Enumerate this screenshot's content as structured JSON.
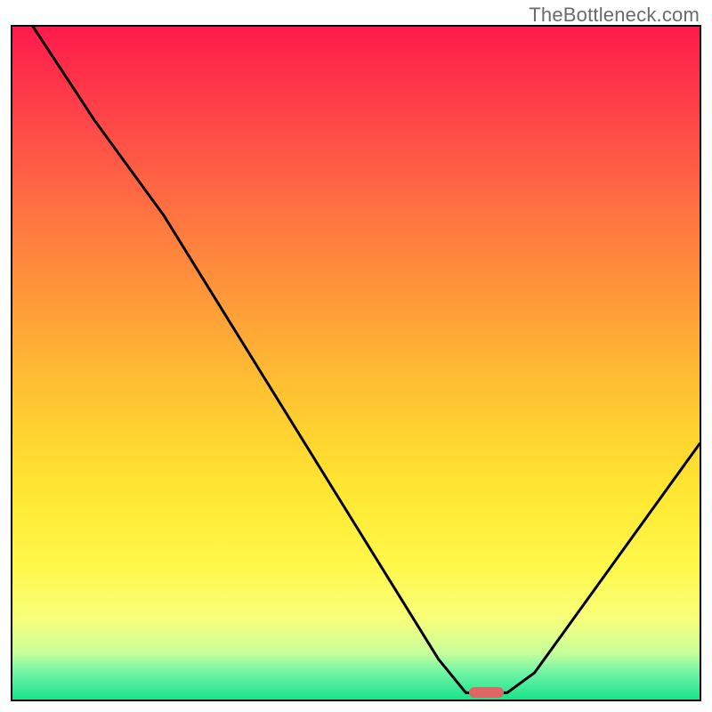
{
  "attribution": "TheBottleneck.com",
  "colors": {
    "border": "#000000",
    "marker": "#e06666",
    "attribution_text": "#6b6b6b",
    "gradient_stops": [
      "#ff1a4b",
      "#ff3a4a",
      "#ff5a46",
      "#ff7a40",
      "#ff983a",
      "#ffb634",
      "#ffd230",
      "#ffe833",
      "#fff84a",
      "#f8ff7a",
      "#c8ff9a",
      "#70f5a5",
      "#19e28a"
    ]
  },
  "chart_data": {
    "type": "line",
    "title": "",
    "xlabel": "",
    "ylabel": "",
    "xlim": [
      0,
      100
    ],
    "ylim": [
      0,
      100
    ],
    "note": "Single V-shaped curve over a vertical red→green gradient. Values estimated from pixels (no axes/labels present).",
    "series": [
      {
        "name": "curve",
        "points": [
          {
            "x": 3,
            "y": 100
          },
          {
            "x": 12,
            "y": 86
          },
          {
            "x": 22,
            "y": 72
          },
          {
            "x": 62,
            "y": 6
          },
          {
            "x": 66,
            "y": 1
          },
          {
            "x": 72,
            "y": 1
          },
          {
            "x": 76,
            "y": 4
          },
          {
            "x": 100,
            "y": 38
          }
        ]
      }
    ],
    "marker": {
      "x_center": 69,
      "y": 1,
      "width_pct": 5
    }
  }
}
